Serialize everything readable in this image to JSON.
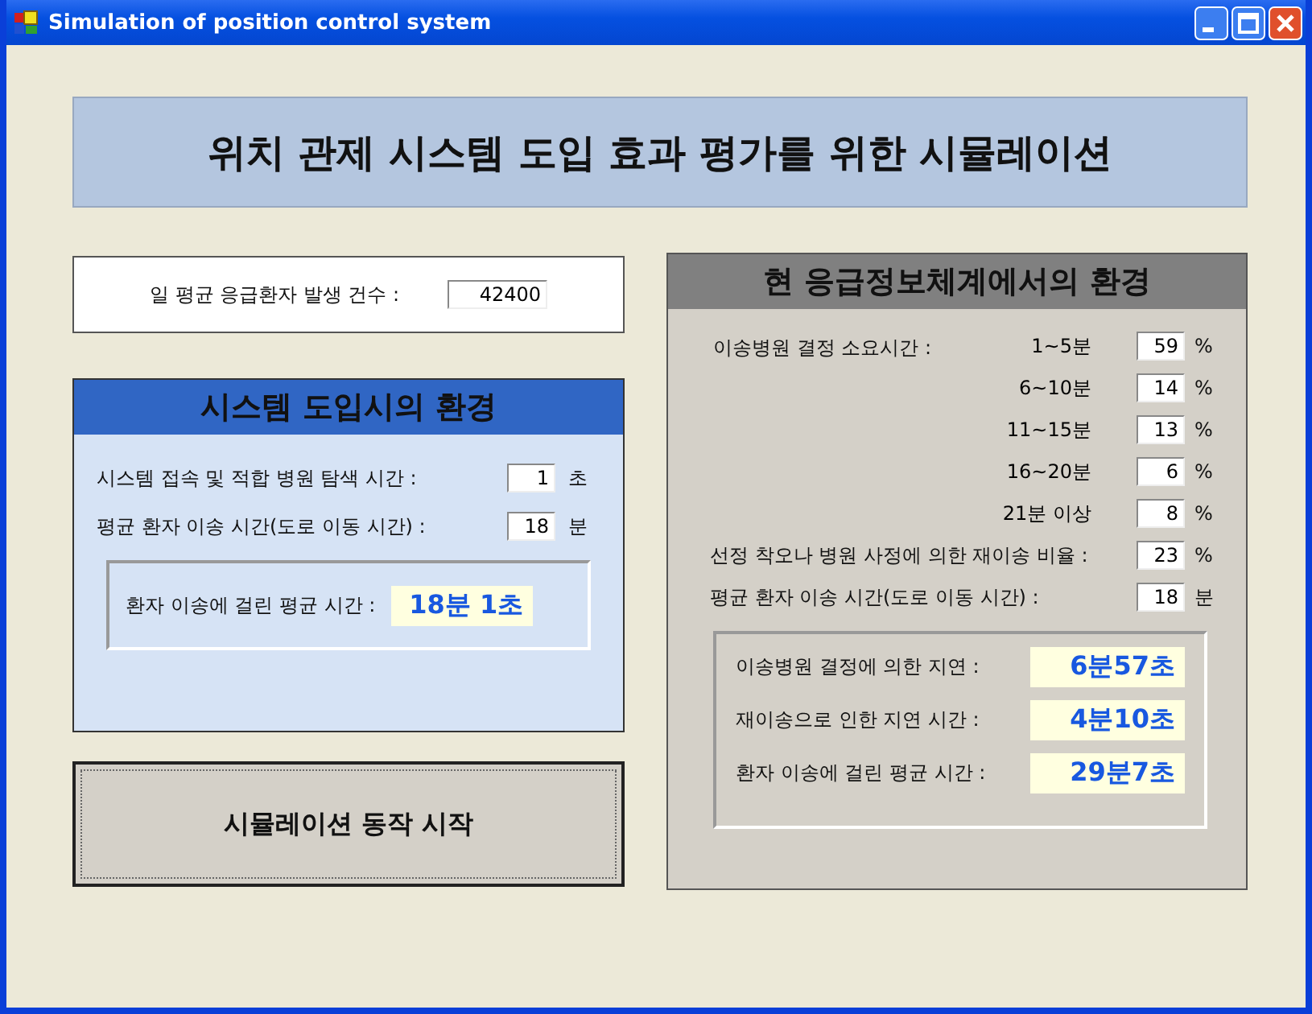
{
  "window": {
    "title": "Simulation of position control system"
  },
  "banner": "위치 관제 시스템 도입 효과 평가를 위한 시뮬레이션",
  "count": {
    "label": "일 평균 응급환자 발생 건수 :",
    "value": "42400"
  },
  "system_panel": {
    "title": "시스템 도입시의 환경",
    "fields": [
      {
        "label": "시스템 접속 및 적합 병원 탐색 시간 :",
        "value": "1",
        "unit": "초"
      },
      {
        "label": "평균 환자 이송 시간(도로 이동 시간) :",
        "value": "18",
        "unit": "분"
      }
    ],
    "result": {
      "label": "환자 이송에 걸린 평균 시간 :",
      "value": "18분 1초"
    }
  },
  "start_button": "시뮬레이션 동작 시작",
  "current_panel": {
    "title": "현 응급정보체계에서의 환경",
    "distribution_label": "이송병원 결정 소요시간 :",
    "distribution": [
      {
        "range": "1~5분",
        "value": "59",
        "unit": "%"
      },
      {
        "range": "6~10분",
        "value": "14",
        "unit": "%"
      },
      {
        "range": "11~15분",
        "value": "13",
        "unit": "%"
      },
      {
        "range": "16~20분",
        "value": "6",
        "unit": "%"
      },
      {
        "range": "21분 이상",
        "value": "8",
        "unit": "%"
      }
    ],
    "fields": [
      {
        "label": "선정 착오나 병원 사정에 의한 재이송 비율 :",
        "value": "23",
        "unit": "%"
      },
      {
        "label": "평균 환자 이송 시간(도로 이동 시간) :",
        "value": "18",
        "unit": "분"
      }
    ],
    "results": [
      {
        "label": "이송병원 결정에 의한 지연 :",
        "value": "6분57초"
      },
      {
        "label": "재이송으로 인한 지연 시간 :",
        "value": "4분10초"
      },
      {
        "label": "환자 이송에 걸린 평균 시간 :",
        "value": "29분7초"
      }
    ]
  }
}
